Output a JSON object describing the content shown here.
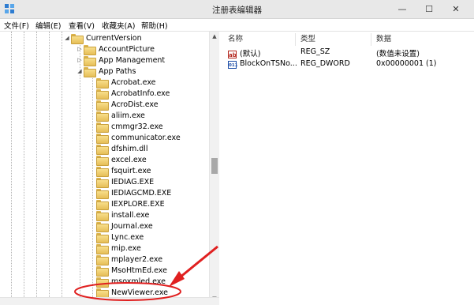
{
  "window": {
    "title": "注册表编辑器",
    "buttons": {
      "minimize": "—",
      "maximize": "☐",
      "close": "✕"
    }
  },
  "menu": [
    "文件(F)",
    "编辑(E)",
    "查看(V)",
    "收藏夹(A)",
    "帮助(H)"
  ],
  "tree": {
    "items": [
      {
        "label": "CurrentVersion",
        "state": "expanded"
      },
      {
        "label": "AccountPicture",
        "state": "collapsed"
      },
      {
        "label": "App Management",
        "state": "collapsed"
      },
      {
        "label": "App Paths",
        "state": "expanded"
      },
      {
        "label": "Acrobat.exe"
      },
      {
        "label": "AcrobatInfo.exe"
      },
      {
        "label": "AcroDist.exe"
      },
      {
        "label": "aliim.exe"
      },
      {
        "label": "cmmgr32.exe"
      },
      {
        "label": "communicator.exe"
      },
      {
        "label": "dfshim.dll"
      },
      {
        "label": "excel.exe"
      },
      {
        "label": "fsquirt.exe"
      },
      {
        "label": "IEDIAG.EXE"
      },
      {
        "label": "IEDIAGCMD.EXE"
      },
      {
        "label": "IEXPLORE.EXE"
      },
      {
        "label": "install.exe"
      },
      {
        "label": "Journal.exe"
      },
      {
        "label": "Lync.exe"
      },
      {
        "label": "mip.exe"
      },
      {
        "label": "mplayer2.exe"
      },
      {
        "label": "MsoHtmEd.exe"
      },
      {
        "label": "msoxmled.exe"
      },
      {
        "label": "NewViewer.exe",
        "highlighted": true
      }
    ]
  },
  "values": {
    "columns": {
      "name": "名称",
      "type": "类型",
      "data": "数据"
    },
    "rows": [
      {
        "name": "(默认)",
        "type": "REG_SZ",
        "data": "(数值未设置)",
        "icon": "string-value-icon"
      },
      {
        "name": "BlockOnTSNo...",
        "type": "REG_DWORD",
        "data": "0x00000001 (1)",
        "icon": "dword-value-icon"
      }
    ]
  },
  "annotation": {
    "color": "#e02020"
  }
}
